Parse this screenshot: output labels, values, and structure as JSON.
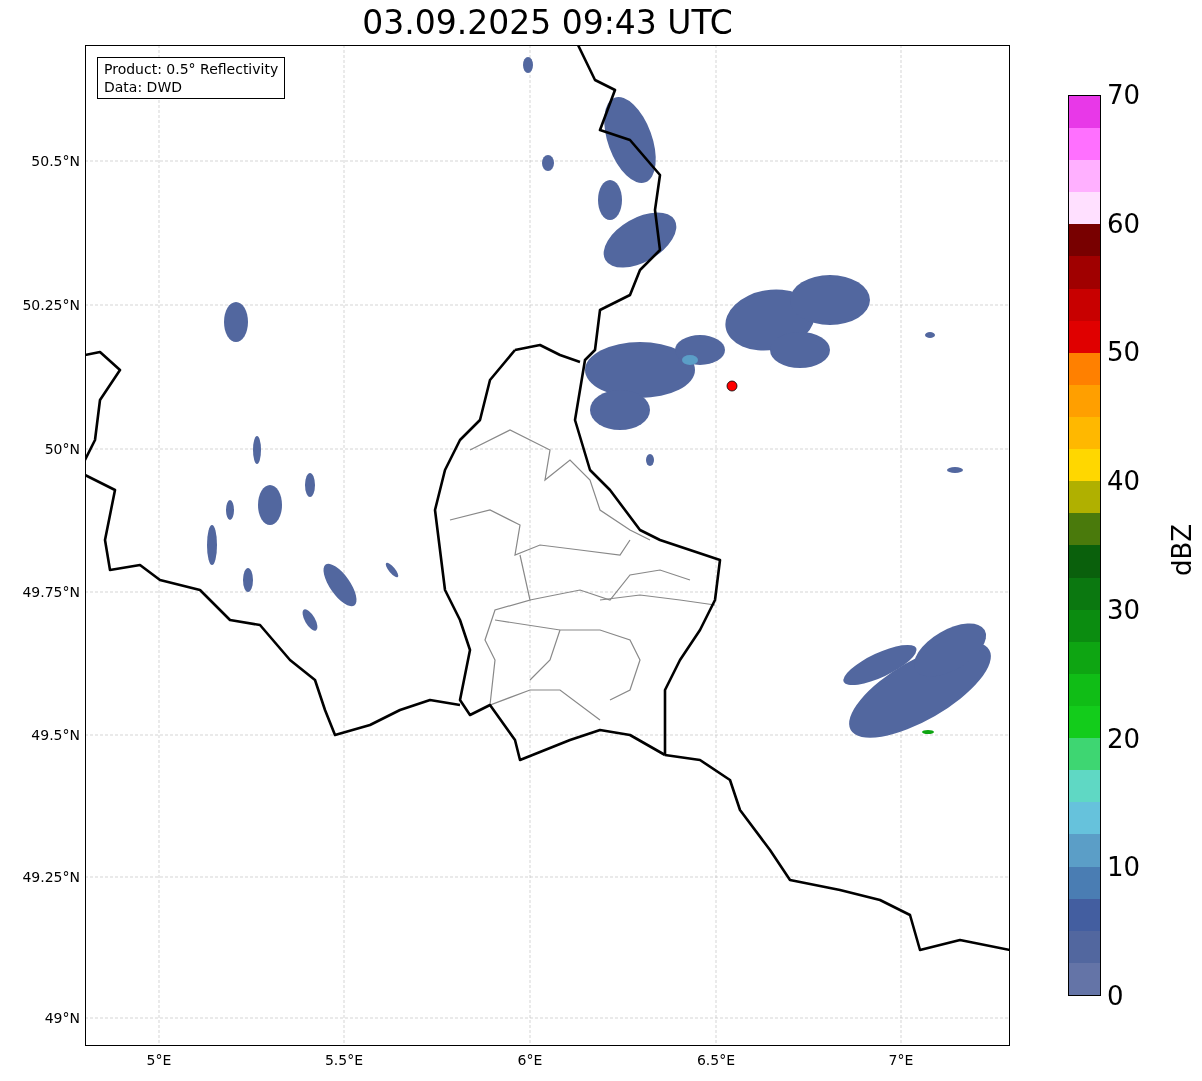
{
  "title": "03.09.2025 09:43 UTC",
  "legend": [
    "Product: 0.5° Reflectivity",
    "Data: DWD"
  ],
  "y_ticks": [
    "50.5°N",
    "50.25°N",
    "50°N",
    "49.75°N",
    "49.5°N",
    "49.25°N",
    "49°N"
  ],
  "x_ticks": [
    "5°E",
    "5.5°E",
    "6°E",
    "6.5°E",
    "7°E"
  ],
  "colorbar": {
    "label": "dBZ",
    "ticks": [
      "70",
      "60",
      "50",
      "40",
      "30",
      "20",
      "10",
      "0"
    ],
    "bins": [
      {
        "color": "#6474a7"
      },
      {
        "color": "#52679f"
      },
      {
        "color": "#435ea0"
      },
      {
        "color": "#4a7db3"
      },
      {
        "color": "#5b9ec7"
      },
      {
        "color": "#66c2dc"
      },
      {
        "color": "#5fd8c4"
      },
      {
        "color": "#3ed672"
      },
      {
        "color": "#13cc1b"
      },
      {
        "color": "#10bd16"
      },
      {
        "color": "#0ea512"
      },
      {
        "color": "#0b8c10"
      },
      {
        "color": "#0b7810"
      },
      {
        "color": "#0a600c"
      },
      {
        "color": "#4a7a0c"
      },
      {
        "color": "#b0b000"
      },
      {
        "color": "#ffd700"
      },
      {
        "color": "#ffb800"
      },
      {
        "color": "#ff9f00"
      },
      {
        "color": "#ff8000"
      },
      {
        "color": "#e00000"
      },
      {
        "color": "#c80000"
      },
      {
        "color": "#a00000"
      },
      {
        "color": "#780000"
      },
      {
        "color": "#ffe0ff"
      },
      {
        "color": "#ffb0ff"
      },
      {
        "color": "#ff70ff"
      },
      {
        "color": "#e838e8"
      }
    ]
  }
}
